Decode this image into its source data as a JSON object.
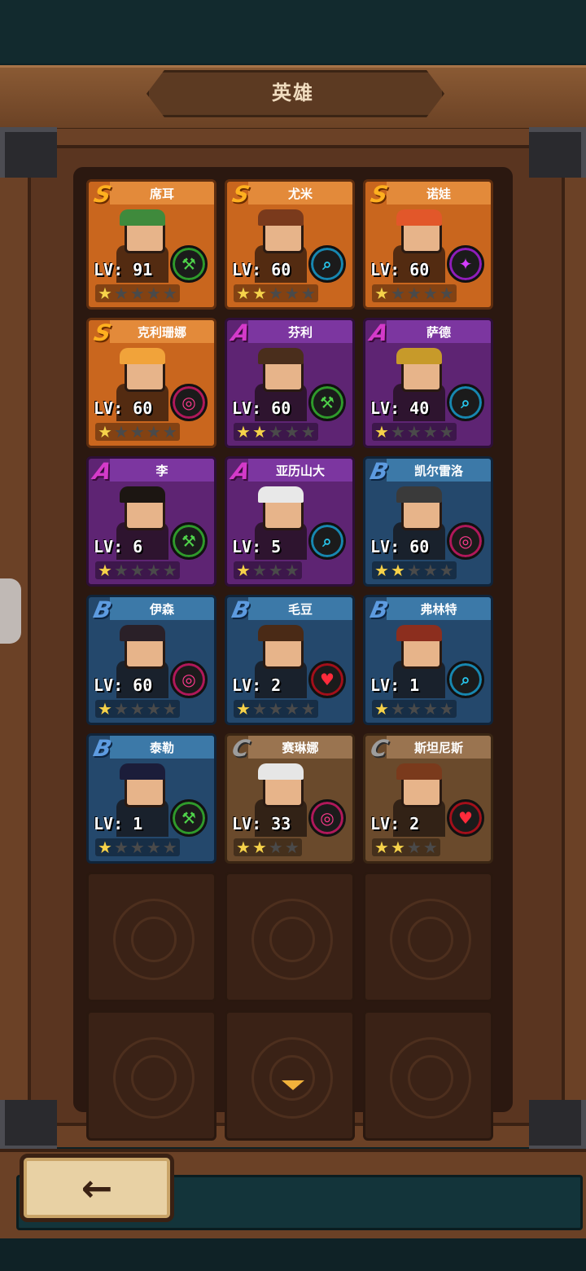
{
  "header": {
    "title": "英雄"
  },
  "heroes": [
    {
      "name": "席耳",
      "rank": "S",
      "level": "LV: 91",
      "stars": 1,
      "stars_total": 5,
      "class_icon": "pickaxe-icon",
      "class_color": "green",
      "hair": "#3f8a3c"
    },
    {
      "name": "尤米",
      "rank": "S",
      "level": "LV: 60",
      "stars": 2,
      "stars_total": 5,
      "class_icon": "magnifier-icon",
      "class_color": "cyan",
      "hair": "#7a3a1c"
    },
    {
      "name": "诺娃",
      "rank": "S",
      "level": "LV: 60",
      "stars": 1,
      "stars_total": 5,
      "class_icon": "wand-icon",
      "class_color": "magenta",
      "hair": "#e2572a"
    },
    {
      "name": "克利珊娜",
      "rank": "S",
      "level": "LV: 60",
      "stars": 1,
      "stars_total": 5,
      "class_icon": "ring-icon",
      "class_color": "pink",
      "hair": "#f1a33a"
    },
    {
      "name": "芬利",
      "rank": "A",
      "level": "LV: 60",
      "stars": 2,
      "stars_total": 5,
      "class_icon": "pickaxe-icon",
      "class_color": "green",
      "hair": "#4a2e1c"
    },
    {
      "name": "萨德",
      "rank": "A",
      "level": "LV: 40",
      "stars": 1,
      "stars_total": 5,
      "class_icon": "magnifier-icon",
      "class_color": "cyan",
      "hair": "#c79a2a"
    },
    {
      "name": "李",
      "rank": "A",
      "level": "LV: 6",
      "stars": 1,
      "stars_total": 5,
      "class_icon": "pickaxe-icon",
      "class_color": "green",
      "hair": "#1c1612"
    },
    {
      "name": "亚历山大",
      "rank": "A",
      "level": "LV: 5",
      "stars": 1,
      "stars_total": 4,
      "class_icon": "magnifier-icon",
      "class_color": "cyan",
      "hair": "#e8e8e8"
    },
    {
      "name": "凯尔雷洛",
      "rank": "B",
      "level": "LV: 60",
      "stars": 2,
      "stars_total": 5,
      "class_icon": "ring-icon",
      "class_color": "pink",
      "hair": "#3a3a3a"
    },
    {
      "name": "伊森",
      "rank": "B",
      "level": "LV: 60",
      "stars": 1,
      "stars_total": 5,
      "class_icon": "ring-icon",
      "class_color": "pink",
      "hair": "#2a2028"
    },
    {
      "name": "毛豆",
      "rank": "B",
      "level": "LV: 2",
      "stars": 1,
      "stars_total": 5,
      "class_icon": "heart-arrow-icon",
      "class_color": "red",
      "hair": "#4a2a16"
    },
    {
      "name": "弗林特",
      "rank": "B",
      "level": "LV: 1",
      "stars": 1,
      "stars_total": 5,
      "class_icon": "magnifier-icon",
      "class_color": "cyan",
      "hair": "#8c2e1e"
    },
    {
      "name": "泰勒",
      "rank": "B",
      "level": "LV: 1",
      "stars": 1,
      "stars_total": 5,
      "class_icon": "pickaxe-icon",
      "class_color": "green",
      "hair": "#1b1d3a"
    },
    {
      "name": "赛琳娜",
      "rank": "C",
      "level": "LV: 33",
      "stars": 2,
      "stars_total": 4,
      "class_icon": "ring-icon",
      "class_color": "pink",
      "hair": "#e6e6e6"
    },
    {
      "name": "斯坦尼斯",
      "rank": "C",
      "level": "LV: 2",
      "stars": 2,
      "stars_total": 4,
      "class_icon": "heart-arrow-icon",
      "class_color": "red",
      "hair": "#7a3a1c"
    }
  ],
  "empty_slots": 6,
  "back_button": {
    "icon": "back-arrow-icon"
  },
  "scroll_indicator": {
    "icon": "chevron-down-icon"
  }
}
